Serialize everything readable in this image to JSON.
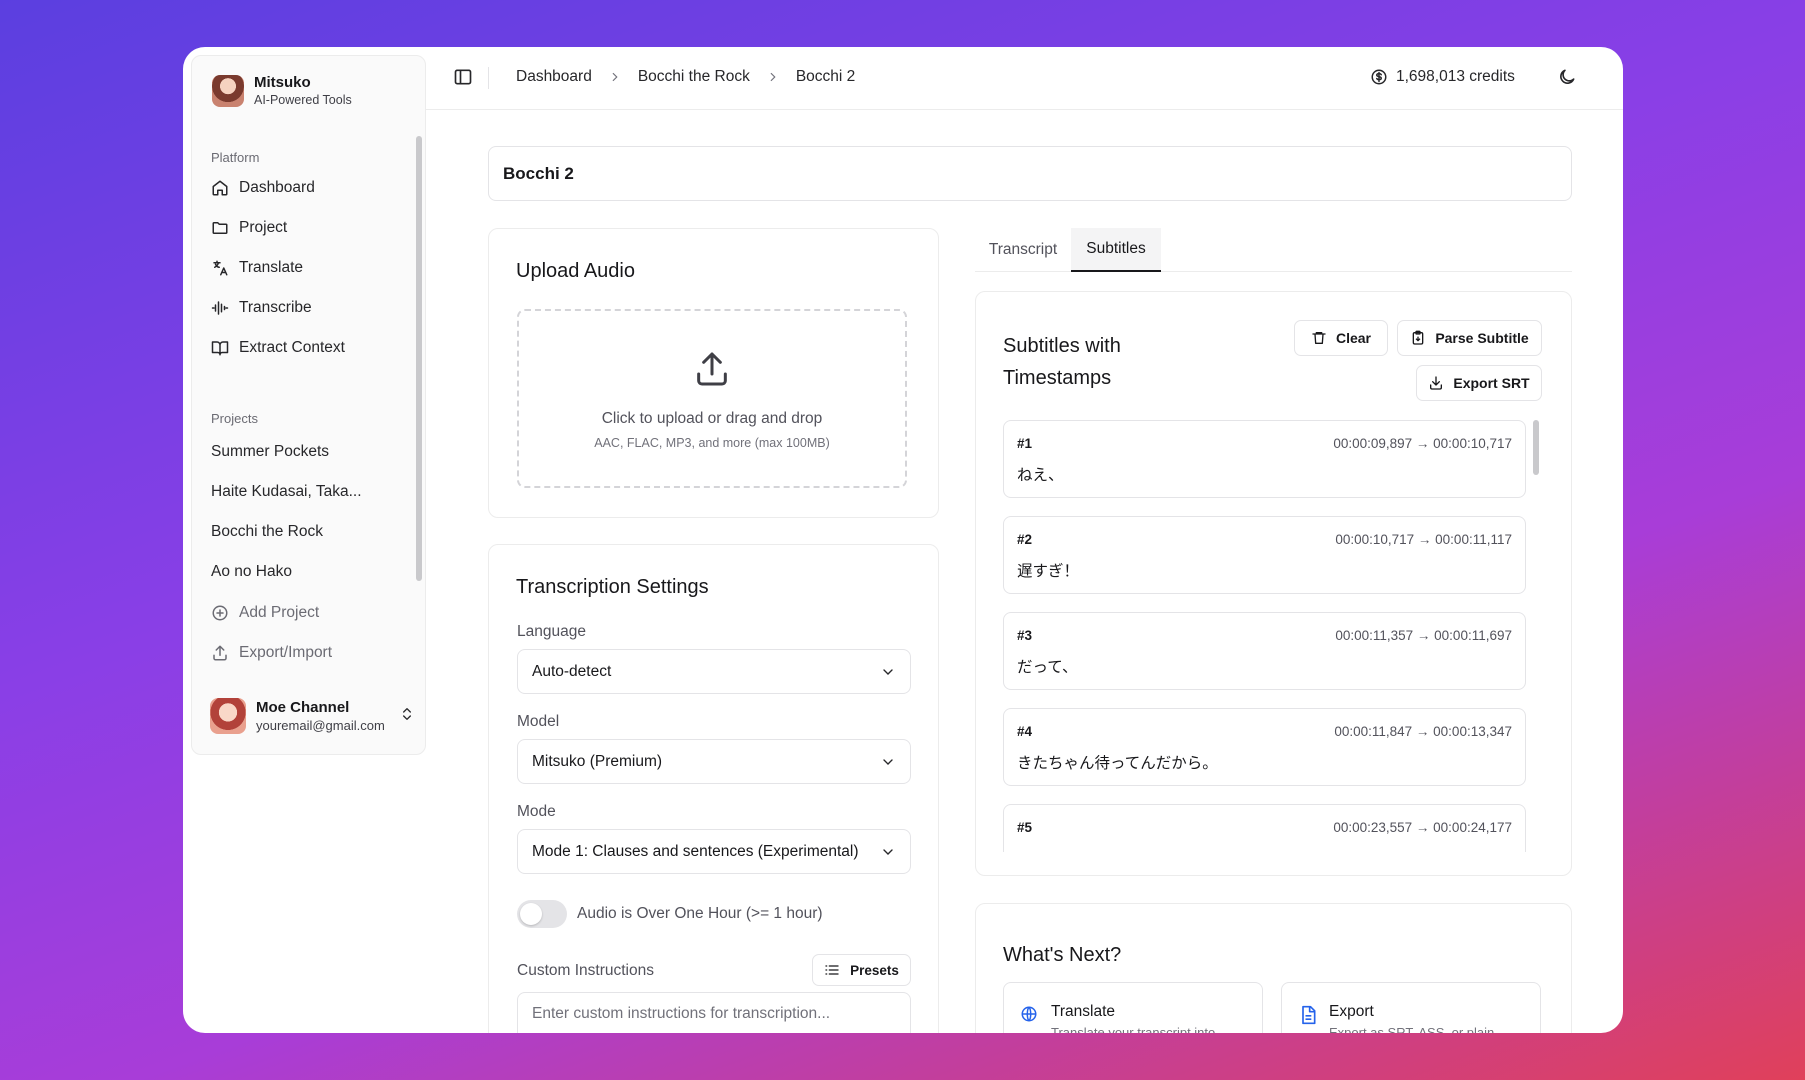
{
  "app": {
    "name": "Mitsuko",
    "tagline": "AI-Powered Tools"
  },
  "sidebar": {
    "platform_label": "Platform",
    "nav": [
      {
        "label": "Dashboard",
        "icon": "home-icon"
      },
      {
        "label": "Project",
        "icon": "folder-icon"
      },
      {
        "label": "Translate",
        "icon": "translate-icon"
      },
      {
        "label": "Transcribe",
        "icon": "audio-waveform-icon"
      },
      {
        "label": "Extract Context",
        "icon": "book-open-icon"
      }
    ],
    "projects_label": "Projects",
    "projects": [
      "Summer Pockets",
      "Haite Kudasai, Taka...",
      "Bocchi the Rock",
      "Ao no Hako"
    ],
    "add_project": "Add Project",
    "export_import": "Export/Import"
  },
  "user": {
    "name": "Moe Channel",
    "email": "youremail@gmail.com"
  },
  "header": {
    "breadcrumbs": [
      "Dashboard",
      "Bocchi the Rock",
      "Bocchi 2"
    ],
    "credits": "1,698,013 credits"
  },
  "page": {
    "title": "Bocchi 2"
  },
  "upload": {
    "title": "Upload Audio",
    "main_text": "Click to upload or drag and drop",
    "sub_text": "AAC, FLAC, MP3, and more (max 100MB)"
  },
  "settings": {
    "title": "Transcription Settings",
    "language_label": "Language",
    "language_value": "Auto-detect",
    "model_label": "Model",
    "model_value": "Mitsuko (Premium)",
    "mode_label": "Mode",
    "mode_value": "Mode 1: Clauses and sentences (Experimental)",
    "over_hour_label": "Audio is Over One Hour (>= 1 hour)",
    "over_hour_enabled": false,
    "custom_label": "Custom Instructions",
    "presets_label": "Presets",
    "custom_placeholder": "Enter custom instructions for transcription..."
  },
  "tabs": {
    "items": [
      "Transcript",
      "Subtitles"
    ],
    "active": "Subtitles"
  },
  "subtitles": {
    "title": "Subtitles with Timestamps",
    "clear_label": "Clear",
    "parse_label": "Parse Subtitle",
    "export_label": "Export SRT",
    "items": [
      {
        "index": "#1",
        "time": "00:00:09,897 → 00:00:10,717",
        "text": "ねえ、"
      },
      {
        "index": "#2",
        "time": "00:00:10,717 → 00:00:11,117",
        "text": "遅すぎ！"
      },
      {
        "index": "#3",
        "time": "00:00:11,357 → 00:00:11,697",
        "text": "だって、"
      },
      {
        "index": "#4",
        "time": "00:00:11,847 → 00:00:13,347",
        "text": "きたちゃん待ってんだから。"
      },
      {
        "index": "#5",
        "time": "00:00:23,557 → 00:00:24,177",
        "text": ""
      }
    ]
  },
  "next": {
    "title": "What's Next?",
    "items": [
      {
        "name": "Translate",
        "desc": "Translate your transcript into",
        "icon": "globe-icon"
      },
      {
        "name": "Export",
        "desc": "Export as SRT, ASS, or plain",
        "icon": "file-text-icon"
      }
    ]
  },
  "colors": {
    "accent": "#18181b",
    "link_blue": "#2563eb",
    "border": "#e4e4e7"
  }
}
